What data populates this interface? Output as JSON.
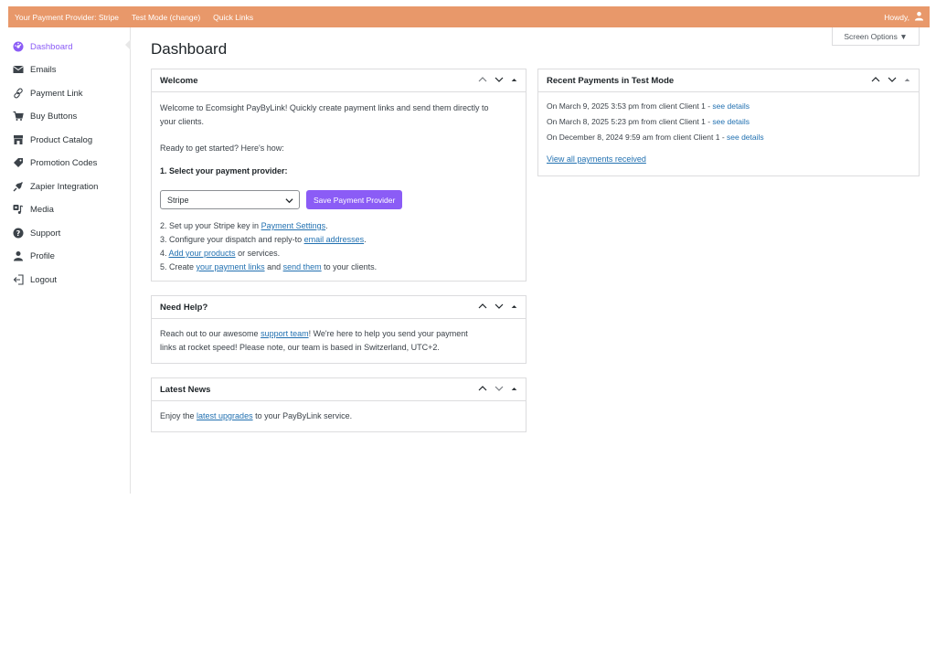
{
  "topbar": {
    "provider": "Your Payment Provider: Stripe",
    "test_mode": "Test Mode (change)",
    "quick_links": "Quick Links",
    "howdy": "Howdy,"
  },
  "sidebar": {
    "items": [
      {
        "label": "Dashboard",
        "icon": "dashboard-icon"
      },
      {
        "label": "Emails",
        "icon": "envelope-icon"
      },
      {
        "label": "Payment Link",
        "icon": "link-icon"
      },
      {
        "label": "Buy Buttons",
        "icon": "cart-icon"
      },
      {
        "label": "Product Catalog",
        "icon": "store-icon"
      },
      {
        "label": "Promotion Codes",
        "icon": "tag-icon"
      },
      {
        "label": "Zapier Integration",
        "icon": "plugin-icon"
      },
      {
        "label": "Media",
        "icon": "media-icon"
      },
      {
        "label": "Support",
        "icon": "help-icon"
      },
      {
        "label": "Profile",
        "icon": "user-icon"
      },
      {
        "label": "Logout",
        "icon": "logout-icon"
      }
    ]
  },
  "page": {
    "title": "Dashboard",
    "screen_options": "Screen Options ▼"
  },
  "welcome": {
    "title": "Welcome",
    "intro_line1": "Welcome to Ecomsight PayByLink! Quickly create payment links and send them directly to",
    "intro_line2": "your clients.",
    "ready": "Ready to get started? Here's how:",
    "step1": "1. Select your payment provider:",
    "provider_value": "Stripe",
    "save_button": "Save Payment Provider",
    "step2_pre": "2. Set up your Stripe key in ",
    "step2_link": "Payment Settings",
    "step2_post": ".",
    "step3_pre": "3. Configure your dispatch and reply-to ",
    "step3_link": "email addresses",
    "step3_post": ".",
    "step4_pre": "4. ",
    "step4_link": "Add your products",
    "step4_post": " or services.",
    "step5_pre": "5. Create ",
    "step5_link1": "your payment links",
    "step5_mid": " and ",
    "step5_link2": "send them",
    "step5_post": " to your clients."
  },
  "help": {
    "title": "Need Help?",
    "line1_pre": "Reach out to our awesome ",
    "line1_link": "support team",
    "line1_post": "! We're here to help you send your payment",
    "line2": "links at rocket speed! Please note, our team is based in Switzerland, UTC+2."
  },
  "news": {
    "title": "Latest News",
    "pre": "Enjoy the ",
    "link": "latest upgrades",
    "post": " to your PayByLink service."
  },
  "payments": {
    "title": "Recent Payments in Test Mode",
    "rows": [
      {
        "text": "On March 9, 2025 3:53 pm from client Client 1 - ",
        "link": "see details"
      },
      {
        "text": "On March 8, 2025 5:23 pm from client Client 1 - ",
        "link": "see details"
      },
      {
        "text": "On December 8, 2024 9:59 am from client Client 1 - ",
        "link": "see details"
      }
    ],
    "view_all": "View all payments received"
  },
  "colors": {
    "topbar": "#e8986a",
    "accent": "#8b5cf6",
    "link": "#2271b1"
  }
}
